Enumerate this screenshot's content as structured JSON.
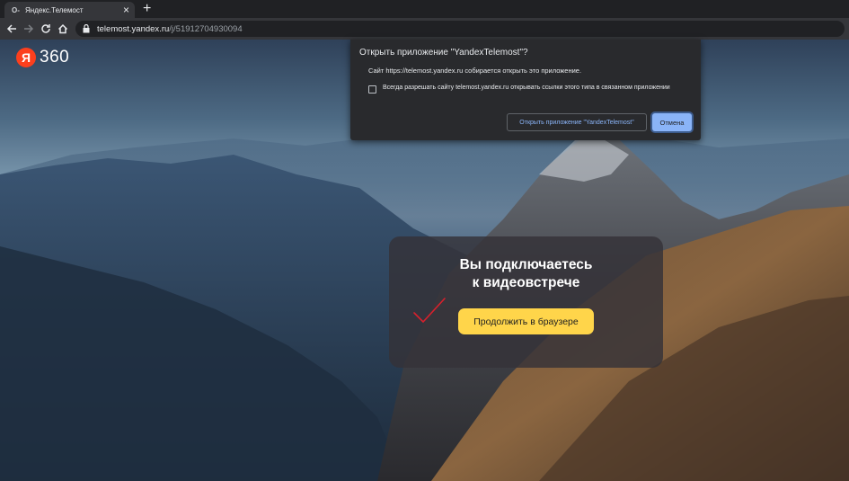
{
  "browser": {
    "tab": {
      "favicon": "О-",
      "title": "Яндекс.Телемост",
      "close": "×"
    },
    "new_tab": "+",
    "url": {
      "host": "telemost.yandex.ru",
      "path": "/j/51912704930094"
    }
  },
  "page": {
    "logo": {
      "letter": "Я",
      "text": "360"
    },
    "card": {
      "title_line1": "Вы подключаетесь",
      "title_line2": "к видеовстрече",
      "continue_label": "Продолжить в браузере"
    }
  },
  "dialog": {
    "title": "Открыть приложение \"YandexTelemost\"?",
    "message": "Сайт https://telemost.yandex.ru собирается открыть это приложение.",
    "checkbox_label": "Всегда разрешать сайту telemost.yandex.ru открывать ссылки этого типа в связанном приложении",
    "checkbox_checked": false,
    "open_label": "Открыть приложение \"YandexTelemost\"",
    "cancel_label": "Отмена"
  },
  "colors": {
    "accent_button": "#ffd54a",
    "yandex_red": "#fc3f1d",
    "dialog_link": "#8ab4f8"
  }
}
